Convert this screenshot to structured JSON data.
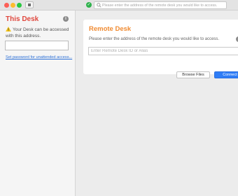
{
  "titlebar": {
    "address_placeholder": "Please enter the address of the remote desk you would like to access."
  },
  "sidebar": {
    "title": "This Desk",
    "message": "Your Desk can be accessed with this address.",
    "link": "Set password for unattended access..."
  },
  "remote": {
    "title": "Remote Desk",
    "description": "Please enter the address of the remote desk you would like to access.",
    "input_placeholder": "Enter Remote Desk ID or Alias",
    "browse_label": "Browse Files",
    "connect_label": "Connect"
  },
  "colors": {
    "sidebar_title": "#e0483e",
    "remote_title": "#f08b32",
    "connect_button": "#2f7df6",
    "link": "#2b6fd6",
    "status_ok": "#2fb24c"
  },
  "icons": [
    "close-window-icon",
    "minimize-window-icon",
    "zoom-window-icon",
    "sidebar-toggle-icon",
    "connection-status-icon",
    "search-icon",
    "info-icon",
    "warning-icon"
  ]
}
